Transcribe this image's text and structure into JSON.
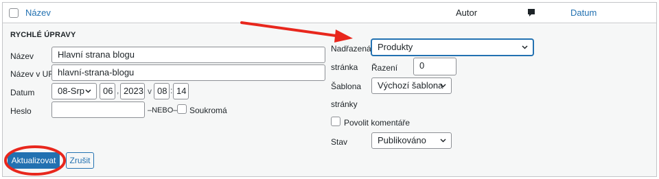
{
  "header": {
    "col_title": "Název",
    "col_author": "Autor",
    "col_date": "Datum"
  },
  "quick_edit": {
    "legend": "RYCHLÉ ÚPRAVY",
    "title_label": "Název",
    "title_value": "Hlavní strana blogu",
    "slug_label": "Název v URL",
    "slug_value": "hlavní-strana-blogu",
    "date_label": "Datum",
    "month": "08-Srp",
    "day": "06",
    "year": "2023",
    "at": "v",
    "hour": "08",
    "minute": "14",
    "date_sep_comma": ",",
    "time_sep_colon": ":",
    "password_label": "Heslo",
    "password_value": "",
    "or_text": "–NEBO–",
    "private_label": "Soukromá",
    "parent_label_1": "Nadřazená",
    "parent_label_2": "stránka",
    "parent_value": "Produkty",
    "order_label": "Řazení",
    "order_value": "0",
    "template_label_1": "Šablona",
    "template_label_2": "stránky",
    "template_value": "Výchozí šablona",
    "comments_label": "Povolit komentáře",
    "status_label": "Stav",
    "status_value": "Publikováno",
    "update_button": "Aktualizovat",
    "cancel_button": "Zrušit"
  },
  "colors": {
    "accent": "#2271b1",
    "annotation": "#e8271d"
  }
}
